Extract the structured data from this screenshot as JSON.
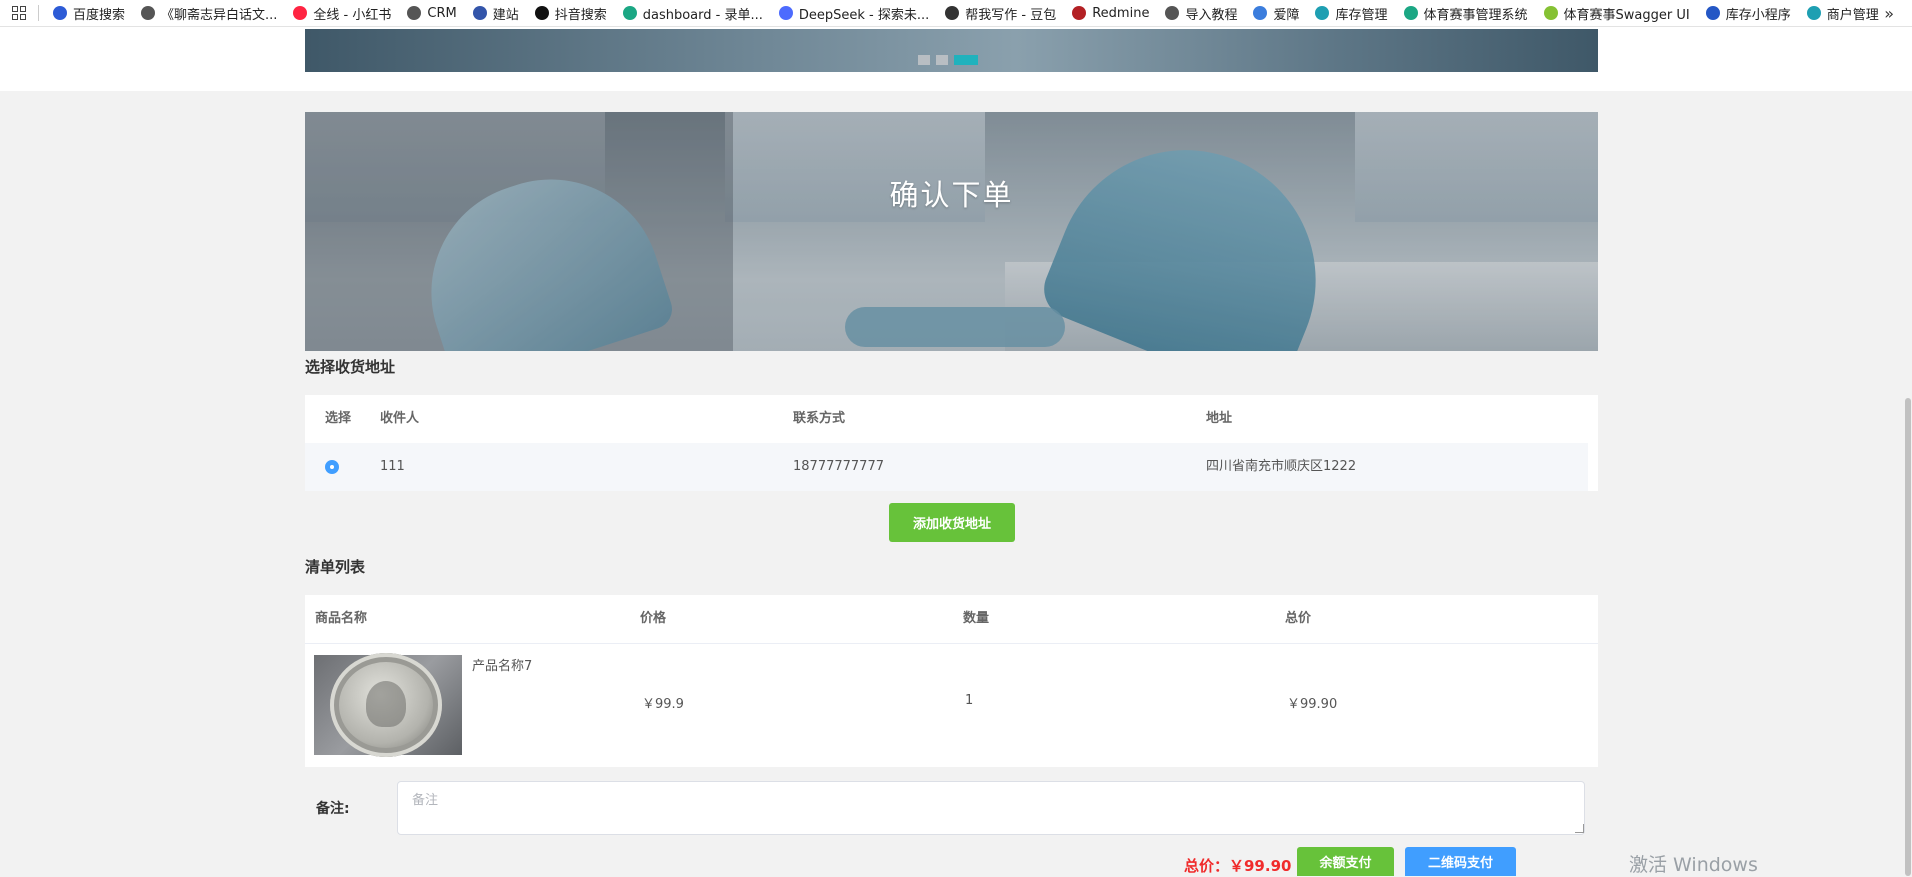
{
  "bookmarks": [
    {
      "label": "百度搜索",
      "color": "#2d5bd6",
      "icon": "baidu-icon"
    },
    {
      "label": "《聊斋志异白话文...",
      "color": "#555555",
      "icon": "globe-icon"
    },
    {
      "label": "全线 - 小红书",
      "color": "#ff2442",
      "icon": "xiaohongshu-icon"
    },
    {
      "label": "CRM",
      "color": "#555555",
      "icon": "globe-icon"
    },
    {
      "label": "建站",
      "color": "#3355aa",
      "icon": "site-icon"
    },
    {
      "label": "抖音搜索",
      "color": "#111111",
      "icon": "douyin-icon"
    },
    {
      "label": "dashboard - 录单...",
      "color": "#1ba784",
      "icon": "dashboard-icon"
    },
    {
      "label": "DeepSeek - 探索未...",
      "color": "#4d6bfe",
      "icon": "deepseek-icon"
    },
    {
      "label": "帮我写作 - 豆包",
      "color": "#333333",
      "icon": "doubao-icon"
    },
    {
      "label": "Redmine",
      "color": "#b32024",
      "icon": "redmine-icon"
    },
    {
      "label": "导入教程",
      "color": "#555555",
      "icon": "globe-icon"
    },
    {
      "label": "爱障",
      "color": "#3b7ddd",
      "icon": "aizhang-icon"
    },
    {
      "label": "库存管理",
      "color": "#1e9fb2",
      "icon": "inventory-icon"
    },
    {
      "label": "体育赛事管理系统",
      "color": "#1ba784",
      "icon": "sports-icon"
    },
    {
      "label": "体育赛事Swagger UI",
      "color": "#85c133",
      "icon": "swagger-icon"
    },
    {
      "label": "库存小程序",
      "color": "#2457c5",
      "icon": "miniapp-icon"
    },
    {
      "label": "商户管理",
      "color": "#1e9fb2",
      "icon": "merchant-icon"
    }
  ],
  "hero": {
    "title": "确认下单"
  },
  "address_section": {
    "title": "选择收货地址",
    "columns": {
      "select": "选择",
      "receiver": "收件人",
      "phone": "联系方式",
      "address": "地址"
    },
    "rows": [
      {
        "receiver": "111",
        "phone": "18777777777",
        "address": "四川省南充市顺庆区1222",
        "selected": true
      }
    ],
    "add_button": "添加收货地址"
  },
  "items_section": {
    "title": "清单列表",
    "columns": {
      "name": "商品名称",
      "price": "价格",
      "quantity": "数量",
      "total": "总价"
    },
    "rows": [
      {
        "name": "产品名称7",
        "price": "￥99.9",
        "quantity": "1",
        "total": "￥99.90"
      }
    ]
  },
  "remark": {
    "label": "备注:",
    "placeholder": "备注",
    "value": ""
  },
  "footer": {
    "total_text": "总价：￥99.90",
    "balance_pay": "余额支付",
    "qr_pay": "二维码支付"
  },
  "watermark": "激活 Windows",
  "colors": {
    "primary_green": "#67c23a",
    "primary_blue": "#409eff",
    "price_red": "#f02b2b",
    "accent_teal": "#20b2bd"
  }
}
